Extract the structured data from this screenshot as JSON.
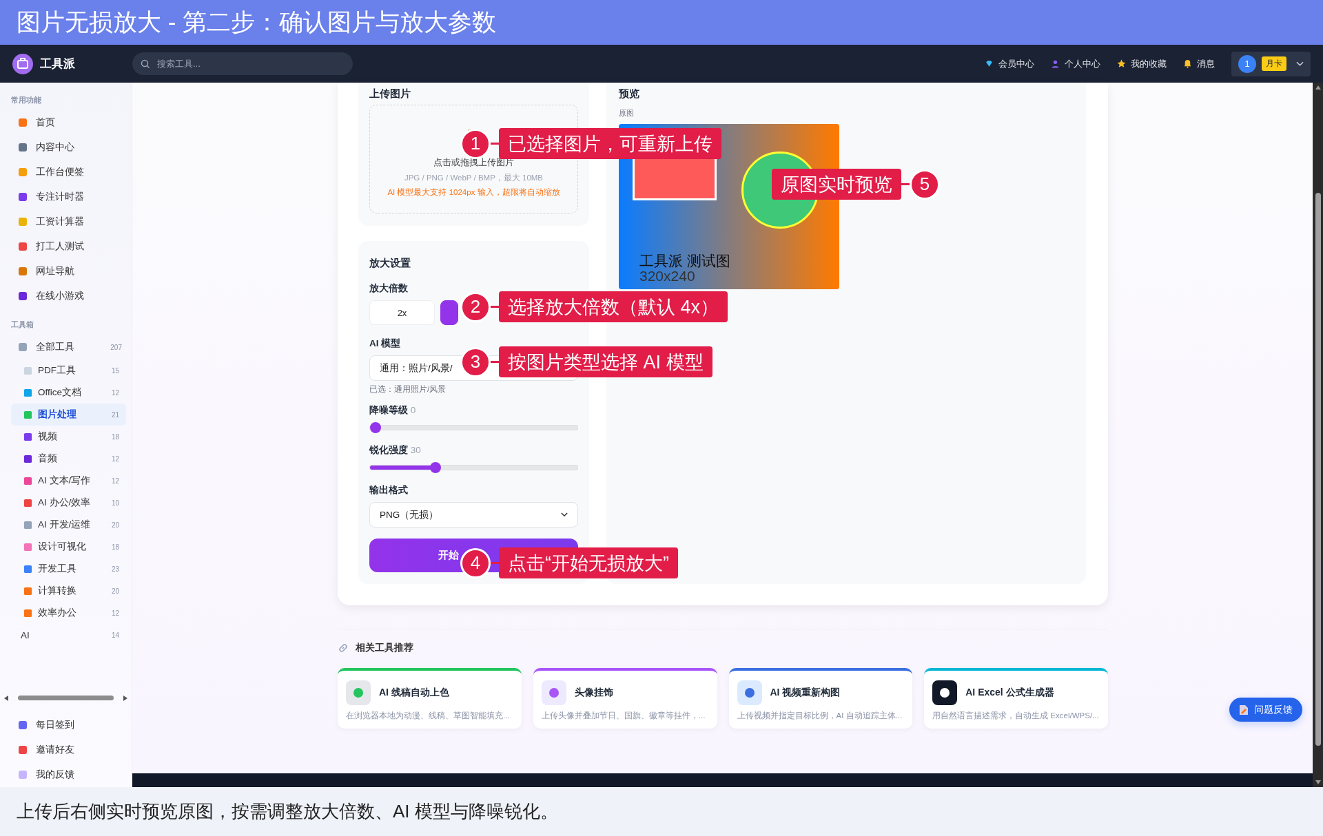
{
  "banner": {
    "title": "图片无损放大 - 第二步：确认图片与放大参数"
  },
  "navbar": {
    "logo": "工具派",
    "search": {
      "placeholder": "搜索工具..."
    },
    "links": [
      {
        "label": "会员中心"
      },
      {
        "label": "个人中心"
      },
      {
        "label": "我的收藏"
      },
      {
        "label": "消息"
      }
    ],
    "user": {
      "avatar": "1",
      "badge": "月卡"
    }
  },
  "sidebar": {
    "sections": [
      {
        "title": "常用功能",
        "items": [
          {
            "label": "首页",
            "selected": false
          },
          {
            "label": "内容中心",
            "selected": false
          },
          {
            "label": "工作台便签",
            "selected": false
          },
          {
            "label": "专注计时器",
            "selected": false
          },
          {
            "label": "工资计算器",
            "selected": false
          },
          {
            "label": "打工人测试",
            "selected": false
          },
          {
            "label": "网址导航",
            "selected": false
          },
          {
            "label": "在线小游戏",
            "selected": false
          }
        ]
      },
      {
        "title": "工具箱",
        "items": [
          {
            "label": "全部工具",
            "count": "207",
            "selected": false,
            "children": [
              {
                "label": "PDF工具",
                "count": "15",
                "selected": false,
                "kind": "tool"
              },
              {
                "label": "Office文档",
                "count": "12",
                "selected": false,
                "kind": "tool"
              },
              {
                "label": "图片处理",
                "count": "21",
                "selected": true,
                "kind": "tool"
              },
              {
                "label": "视频",
                "count": "18",
                "selected": false,
                "kind": "tool"
              },
              {
                "label": "音频",
                "count": "12",
                "selected": false,
                "kind": "tool"
              },
              {
                "label": "AI 文本/写作",
                "count": "12",
                "selected": false,
                "kind": "tool"
              },
              {
                "label": "AI 办公/效率",
                "count": "10",
                "selected": false,
                "kind": "tool"
              },
              {
                "label": "AI 开发/运维",
                "count": "20",
                "selected": false,
                "kind": "tool"
              },
              {
                "label": "设计可视化",
                "count": "18",
                "selected": false,
                "kind": "tool"
              },
              {
                "label": "开发工具",
                "count": "23",
                "selected": false,
                "kind": "tool"
              },
              {
                "label": "计算转换",
                "count": "20",
                "selected": false,
                "kind": "tool"
              },
              {
                "label": "效率办公",
                "count": "12",
                "selected": false,
                "kind": "tool"
              },
              {
                "label": "AI",
                "count": "14",
                "selected": false,
                "kind": "plain"
              }
            ]
          }
        ]
      }
    ],
    "footer_items": [
      {
        "label": "每日签到",
        "selected": false
      },
      {
        "label": "邀请好友",
        "selected": false
      },
      {
        "label": "我的反馈",
        "selected": false
      }
    ]
  },
  "upload": {
    "title": "上传图片",
    "hint": "点击或拖拽上传图片",
    "formats": "JPG / PNG / WebP / BMP，最大 10MB",
    "warning": "AI 模型最大支持 1024px 输入，超限将自动缩放"
  },
  "settings": {
    "title": "放大设置",
    "scale": {
      "label": "放大倍数",
      "options": [
        {
          "label": "2x",
          "selected": false
        },
        {
          "selected": true
        }
      ]
    },
    "model": {
      "label": "AI 模型",
      "value": "通用：照片/风景/",
      "note": "已选：通用照片/风景"
    },
    "sliders": [
      {
        "label": "降噪等级",
        "reading": "0",
        "level": 0
      },
      {
        "label": "锐化强度",
        "reading": "30",
        "level": 0.3
      }
    ],
    "format": {
      "label": "输出格式",
      "value": "PNG（无损）"
    },
    "start_button": "开始"
  },
  "preview": {
    "title": "预览",
    "caption": "原图",
    "image": {
      "title": "工具派 测试图",
      "size": "320x240"
    }
  },
  "callouts": [
    {
      "number": "1",
      "text": "已选择图片，可重新上传"
    },
    {
      "number": "2",
      "text": "选择放大倍数（默认 4x）"
    },
    {
      "number": "3",
      "text": "按图片类型选择 AI 模型"
    },
    {
      "number": "4",
      "text": "点击“开始无损放大”"
    },
    {
      "number": "5",
      "text": "原图实时预览"
    }
  ],
  "related": {
    "title": "相关工具推荐",
    "cards": [
      {
        "title": "AI 线稿自动上色",
        "description": "在浏览器本地为动漫、线稿、草图智能填充...",
        "color": "#22c55e"
      },
      {
        "title": "头像挂饰",
        "description": "上传头像并叠加节日、国旗、徽章等挂件，...",
        "color": "#a855f7"
      },
      {
        "title": "AI 视频重新构图",
        "description": "上传视频并指定目标比例，AI 自动追踪主体...",
        "color": "#3b6fe0"
      },
      {
        "title": "AI Excel 公式生成器",
        "description": "用自然语言描述需求，自动生成 Excel/WPS/...",
        "color": "#06b6d4"
      }
    ]
  },
  "feedback_button": "问题反馈",
  "caption": "上传后右侧实时预览原图，按需调整放大倍数、AI 模型与降噪锐化。"
}
